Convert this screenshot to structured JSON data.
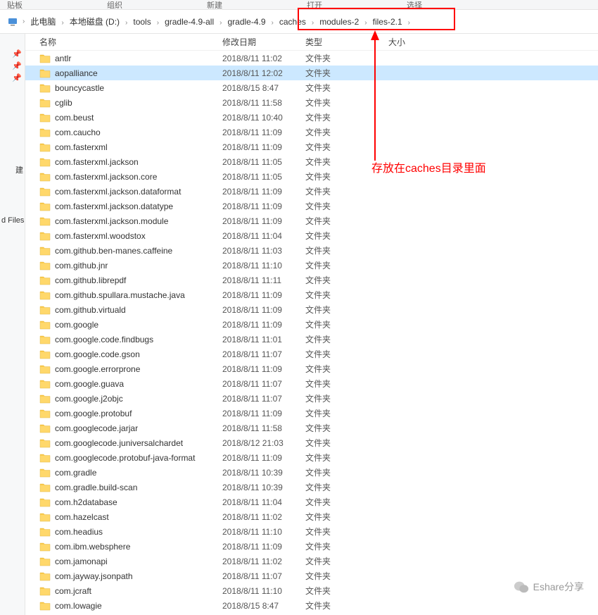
{
  "toolbar": {
    "paste": "贴板",
    "organize": "组织",
    "new": "新建",
    "open": "打开",
    "select": "选择"
  },
  "breadcrumb": {
    "items": [
      "此电脑",
      "本地磁盘 (D:)",
      "tools",
      "gradle-4.9-all",
      "gradle-4.9",
      "caches",
      "modules-2",
      "files-2.1"
    ]
  },
  "columns": {
    "name": "名称",
    "date": "修改日期",
    "type": "类型",
    "size": "大小"
  },
  "leftpane": {
    "quick": "建",
    "drives": "d Files"
  },
  "annotation": "存放在caches目录里面",
  "watermark": "Eshare分享",
  "folder_type": "文件夹",
  "files": [
    {
      "name": "antlr",
      "date": "2018/8/11 11:02"
    },
    {
      "name": "aopalliance",
      "date": "2018/8/11 12:02",
      "selected": true
    },
    {
      "name": "bouncycastle",
      "date": "2018/8/15 8:47"
    },
    {
      "name": "cglib",
      "date": "2018/8/11 11:58"
    },
    {
      "name": "com.beust",
      "date": "2018/8/11 10:40"
    },
    {
      "name": "com.caucho",
      "date": "2018/8/11 11:09"
    },
    {
      "name": "com.fasterxml",
      "date": "2018/8/11 11:09"
    },
    {
      "name": "com.fasterxml.jackson",
      "date": "2018/8/11 11:05"
    },
    {
      "name": "com.fasterxml.jackson.core",
      "date": "2018/8/11 11:05"
    },
    {
      "name": "com.fasterxml.jackson.dataformat",
      "date": "2018/8/11 11:09"
    },
    {
      "name": "com.fasterxml.jackson.datatype",
      "date": "2018/8/11 11:09"
    },
    {
      "name": "com.fasterxml.jackson.module",
      "date": "2018/8/11 11:09"
    },
    {
      "name": "com.fasterxml.woodstox",
      "date": "2018/8/11 11:04"
    },
    {
      "name": "com.github.ben-manes.caffeine",
      "date": "2018/8/11 11:03"
    },
    {
      "name": "com.github.jnr",
      "date": "2018/8/11 11:10"
    },
    {
      "name": "com.github.librepdf",
      "date": "2018/8/11 11:11"
    },
    {
      "name": "com.github.spullara.mustache.java",
      "date": "2018/8/11 11:09"
    },
    {
      "name": "com.github.virtuald",
      "date": "2018/8/11 11:09"
    },
    {
      "name": "com.google",
      "date": "2018/8/11 11:09"
    },
    {
      "name": "com.google.code.findbugs",
      "date": "2018/8/11 11:01"
    },
    {
      "name": "com.google.code.gson",
      "date": "2018/8/11 11:07"
    },
    {
      "name": "com.google.errorprone",
      "date": "2018/8/11 11:09"
    },
    {
      "name": "com.google.guava",
      "date": "2018/8/11 11:07"
    },
    {
      "name": "com.google.j2objc",
      "date": "2018/8/11 11:07"
    },
    {
      "name": "com.google.protobuf",
      "date": "2018/8/11 11:09"
    },
    {
      "name": "com.googlecode.jarjar",
      "date": "2018/8/11 11:58"
    },
    {
      "name": "com.googlecode.juniversalchardet",
      "date": "2018/8/12 21:03"
    },
    {
      "name": "com.googlecode.protobuf-java-format",
      "date": "2018/8/11 11:09"
    },
    {
      "name": "com.gradle",
      "date": "2018/8/11 10:39"
    },
    {
      "name": "com.gradle.build-scan",
      "date": "2018/8/11 10:39"
    },
    {
      "name": "com.h2database",
      "date": "2018/8/11 11:04"
    },
    {
      "name": "com.hazelcast",
      "date": "2018/8/11 11:02"
    },
    {
      "name": "com.headius",
      "date": "2018/8/11 11:10"
    },
    {
      "name": "com.ibm.websphere",
      "date": "2018/8/11 11:09"
    },
    {
      "name": "com.jamonapi",
      "date": "2018/8/11 11:02"
    },
    {
      "name": "com.jayway.jsonpath",
      "date": "2018/8/11 11:07"
    },
    {
      "name": "com.jcraft",
      "date": "2018/8/11 11:10"
    },
    {
      "name": "com.lowagie",
      "date": "2018/8/15 8:47"
    }
  ]
}
